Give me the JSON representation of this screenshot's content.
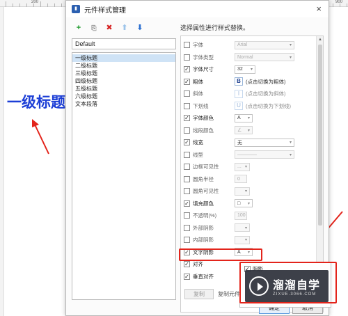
{
  "ruler": {
    "marks": [
      "200",
      "900"
    ]
  },
  "canvas": {
    "heading_text": "一级标题"
  },
  "dialog": {
    "title": "元件样式管理",
    "close": "×",
    "toolbar": {
      "add": "+",
      "copy": "⎘",
      "delete": "✖",
      "up": "⬆",
      "down": "⬇"
    },
    "style_select_value": "Default",
    "styles": [
      "一级标题",
      "二级标题",
      "三级标题",
      "四级标题",
      "五级标题",
      "六级标题",
      "文本段落"
    ],
    "selected_style": "一级标题",
    "hint": "选择属性进行样式替换。",
    "properties": [
      {
        "label": "字体",
        "checked": false,
        "value": "Arial",
        "type": "select"
      },
      {
        "label": "字体类型",
        "checked": false,
        "value": "Normal",
        "type": "select"
      },
      {
        "label": "字体尺寸",
        "checked": true,
        "value": "32",
        "type": "small-select"
      },
      {
        "label": "粗体",
        "checked": true,
        "button": "B",
        "text": "(点击切换为粗体)",
        "type": "format"
      },
      {
        "label": "斜体",
        "checked": false,
        "button": "I",
        "text": "(点击切换为斜体)",
        "type": "format"
      },
      {
        "label": "下划线",
        "checked": false,
        "button": "U",
        "text": "(点击切换为下划线)",
        "type": "format"
      },
      {
        "label": "字体颜色",
        "checked": true,
        "value": "A",
        "type": "color"
      },
      {
        "label": "线段颜色",
        "checked": false,
        "value": "∠",
        "type": "color"
      },
      {
        "label": "线宽",
        "checked": true,
        "value": "无",
        "type": "select"
      },
      {
        "label": "线型",
        "checked": false,
        "value": "————",
        "type": "select"
      },
      {
        "label": "边框可见性",
        "checked": false,
        "value": "...",
        "type": "small"
      },
      {
        "label": "圆角半径",
        "checked": false,
        "value": "0",
        "type": "input"
      },
      {
        "label": "圆角可见性",
        "checked": false,
        "value": "",
        "type": "small"
      },
      {
        "label": "填充颜色",
        "checked": true,
        "value": "□",
        "type": "color"
      },
      {
        "label": "不透明(%)",
        "checked": false,
        "value": "100",
        "type": "input"
      },
      {
        "label": "外部阴影",
        "checked": false,
        "value": "",
        "type": "small"
      },
      {
        "label": "内部阴影",
        "checked": false,
        "value": "",
        "type": "small"
      },
      {
        "label": "文字阴影",
        "checked": true,
        "value": "A",
        "type": "color"
      },
      {
        "label": "对齐",
        "checked": true,
        "value": "",
        "type": "none"
      },
      {
        "label": "垂直对齐",
        "checked": true,
        "value": "",
        "type": "none"
      }
    ],
    "popup_item": "阴影",
    "apply_button": "复制",
    "apply_text": "复制元件",
    "ok": "确定",
    "cancel": "取消"
  },
  "watermark": {
    "title": "溜溜自学",
    "subtitle": "ZIXUE.3066.COM"
  },
  "colors": {
    "annotation_red": "#e3241b",
    "heading_blue": "#1d3fd6",
    "selection": "#cfe3f6"
  }
}
